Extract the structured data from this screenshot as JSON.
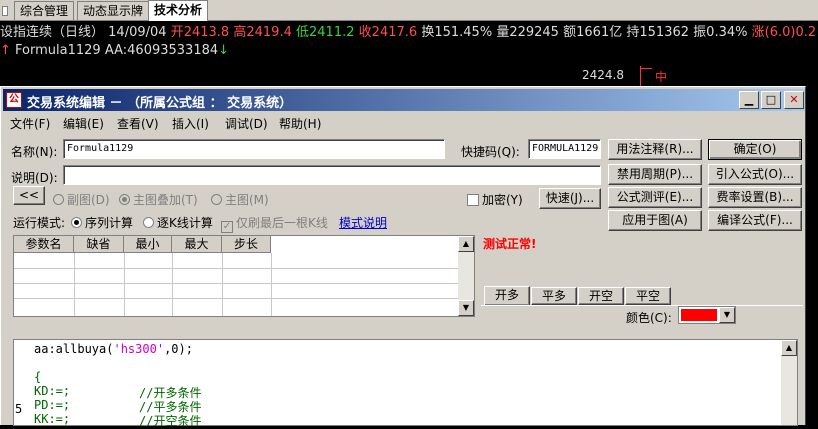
{
  "top_tabs": [
    "综合管理",
    "动态显示牌",
    "技术分析"
  ],
  "quote": {
    "title": "设指连续（日线）",
    "date": "14/09/04",
    "open_label": "开",
    "open": "2413.8",
    "high_label": "高",
    "high": "2419.4",
    "low_label": "低",
    "low": "2411.2",
    "close_label": "收",
    "close": "2417.6",
    "turnover_label": "换",
    "turnover": "151.45%",
    "volume_label": "量",
    "volume": "229245",
    "amount_label": "额",
    "amount": "1661亿",
    "hold_label": "持",
    "hold": "151362",
    "amplitude_label": "振",
    "amplitude": "0.34%",
    "change_label": "涨",
    "change": "(6.0)0.2"
  },
  "formula_line": {
    "name": "Formula1129",
    "aa_label": "AA:",
    "aa_value": "46093533184"
  },
  "chart_price": "2424.8",
  "chart_marker": "中",
  "dialog": {
    "title": "交易系统编辑 － （所属公式组 ： 交易系统）",
    "menu": [
      "文件(F)",
      "编辑(E)",
      "查看(V)",
      "插入(I)",
      "调试(D)",
      "帮助(H)"
    ],
    "name_label": "名称(N):",
    "name_value": "Formula1129",
    "shortcut_label": "快捷码(Q):",
    "shortcut_value": "FORMULA1129",
    "desc_label": "说明(D):",
    "desc_value": "",
    "collapse_button": "<<",
    "pane_options": [
      "副图(D)",
      "主图叠加(T)",
      "主图(M)"
    ],
    "encrypt_label": "加密(Y)",
    "speed_button": "快速(J)...",
    "run_mode_label": "运行模式:",
    "run_modes": [
      "序列计算",
      "逐K线计算"
    ],
    "last_bar_label": "仅刷最后一根K线",
    "mode_link": "模式说明",
    "param_headers": [
      "参数名",
      "缺省",
      "最小",
      "最大",
      "步长"
    ],
    "buttons_left": [
      "用法注释(R)...",
      "禁用周期(P)...",
      "公式测评(E)...",
      "应用于图(A)"
    ],
    "buttons_right": [
      "确定(O)",
      "引入公式(O)...",
      "费率设置(B)...",
      "编译公式(F)..."
    ],
    "status": "测试正常!",
    "trade_tabs": [
      "开多",
      "平多",
      "开空",
      "平空"
    ],
    "color_label": "颜色(C):",
    "color_value": "#ff0000",
    "line_number": "5",
    "code_lines": [
      {
        "a": "aa:allbuya(",
        "b": "'hs300'",
        "c": ",0);",
        "comment": ""
      },
      {
        "a": "",
        "b": "",
        "c": "",
        "comment": ""
      },
      {
        "a": "{",
        "b": "",
        "c": "",
        "comment": ""
      },
      {
        "a": "KD:=;",
        "b": "",
        "c": "",
        "comment": "//开多条件"
      },
      {
        "a": "PD:=;",
        "b": "",
        "c": "",
        "comment": "//平多条件"
      },
      {
        "a": "KK:=;",
        "b": "",
        "c": "",
        "comment": "//开空条件"
      }
    ]
  }
}
